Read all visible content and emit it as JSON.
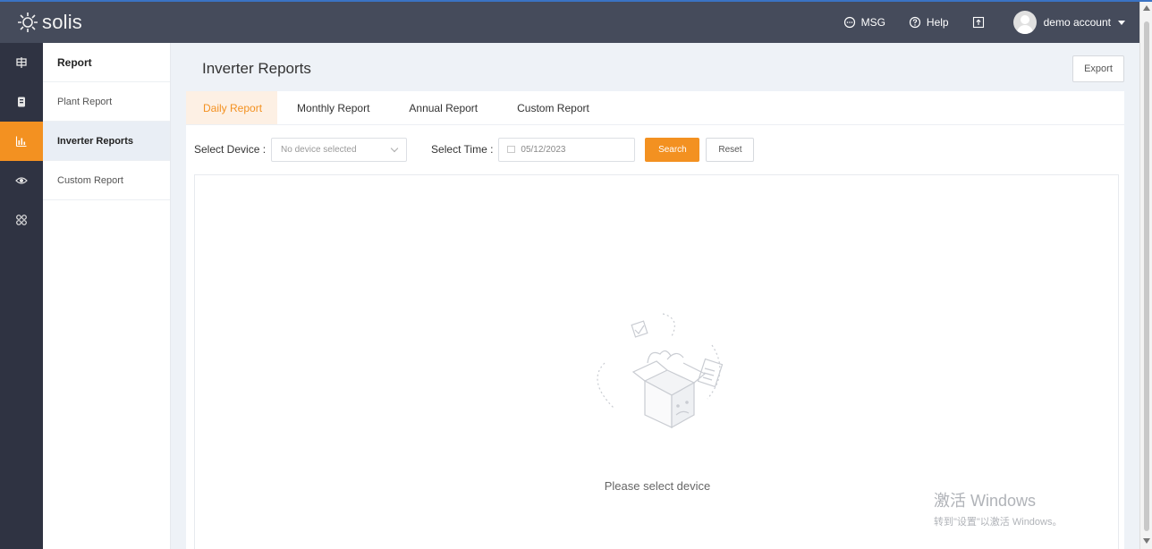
{
  "app": {
    "brand": "solis",
    "top_nav": {
      "msg": "MSG",
      "help": "Help",
      "account": "demo account"
    }
  },
  "rail": {
    "items": [
      {
        "icon": "plant-icon",
        "active": false
      },
      {
        "icon": "device-icon",
        "active": false
      },
      {
        "icon": "report-chart-icon",
        "active": true
      },
      {
        "icon": "eye-icon",
        "active": false
      },
      {
        "icon": "apps-grid-icon",
        "active": false
      }
    ]
  },
  "subnav": {
    "title": "Report",
    "items": [
      {
        "label": "Plant Report",
        "active": false
      },
      {
        "label": "Inverter Reports",
        "active": true
      },
      {
        "label": "Custom Report",
        "active": false
      }
    ]
  },
  "main": {
    "title": "Inverter Reports",
    "export_label": "Export",
    "tabs": [
      {
        "label": "Daily Report",
        "active": true
      },
      {
        "label": "Monthly Report",
        "active": false
      },
      {
        "label": "Annual Report",
        "active": false
      },
      {
        "label": "Custom Report",
        "active": false
      }
    ],
    "filter": {
      "device_label": "Select Device :",
      "device_placeholder": "No device selected",
      "time_label": "Select Time :",
      "time_value": "05/12/2023",
      "search_label": "Search",
      "reset_label": "Reset"
    },
    "empty_text": "Please select device"
  },
  "watermark": {
    "line1": "激活 Windows",
    "line2": "转到\"设置\"以激活 Windows。"
  },
  "colors": {
    "accent": "#f39121",
    "topbar": "#454b5b",
    "rail": "#2f3342"
  }
}
